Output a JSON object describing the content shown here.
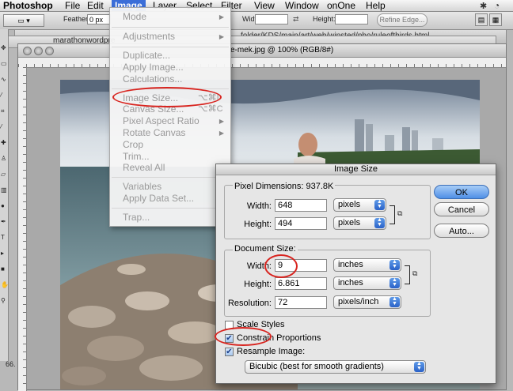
{
  "menubar": {
    "app": "Photoshop",
    "items": [
      "File",
      "Edit",
      "Image",
      "Layer",
      "Select",
      "Filter",
      "View",
      "Window",
      "onOne",
      "Help"
    ]
  },
  "options": {
    "feather_label": "Feather:",
    "feather_value": "0 px",
    "width_label": "Width:",
    "height_label": "Height:",
    "refine_edge": "Refine Edge..."
  },
  "windows": {
    "path_fragment": "folder/KDS/main/art/web/winsted/pho/ruleofthirds.html",
    "tab_fragment": "marathonwordpre",
    "doc_title": "e-mek.jpg @ 100% (RGB/8#)",
    "status_zoom": "66."
  },
  "image_menu": {
    "mode": "Mode",
    "adjustments": "Adjustments",
    "duplicate": "Duplicate...",
    "apply_image": "Apply Image...",
    "calculations": "Calculations...",
    "image_size": "Image Size...",
    "image_size_shortcut": "⌥⌘I",
    "canvas_size": "Canvas Size...",
    "canvas_size_shortcut": "⌥⌘C",
    "pixel_aspect_ratio": "Pixel Aspect Ratio",
    "rotate_canvas": "Rotate Canvas",
    "crop": "Crop",
    "trim": "Trim...",
    "reveal_all": "Reveal All",
    "variables": "Variables",
    "apply_data_set": "Apply Data Set...",
    "trap": "Trap..."
  },
  "dialog": {
    "title": "Image Size",
    "pixel_dimensions_label": "Pixel Dimensions:",
    "pixel_dimensions_value": "937.8K",
    "width_label": "Width:",
    "height_label": "Height:",
    "pixel_width": "648",
    "pixel_height": "494",
    "pixel_unit_width": "pixels",
    "pixel_unit_height": "pixels",
    "document_size_label": "Document Size:",
    "doc_width": "9",
    "doc_height": "6.861",
    "doc_unit_width": "inches",
    "doc_unit_height": "inches",
    "resolution_label": "Resolution:",
    "resolution": "72",
    "resolution_unit": "pixels/inch",
    "scale_styles": "Scale Styles",
    "scale_styles_checked": false,
    "constrain_proportions": "Constrain Proportions",
    "constrain_checked": true,
    "resample_image": "Resample Image:",
    "resample_checked": true,
    "resample_method": "Bicubic (best for smooth gradients)",
    "ok": "OK",
    "cancel": "Cancel",
    "auto": "Auto..."
  },
  "colors": {
    "menu_highlight": "#3b6ed8",
    "annotation_red": "#d8241f",
    "default_button": "#4f8fe6"
  }
}
